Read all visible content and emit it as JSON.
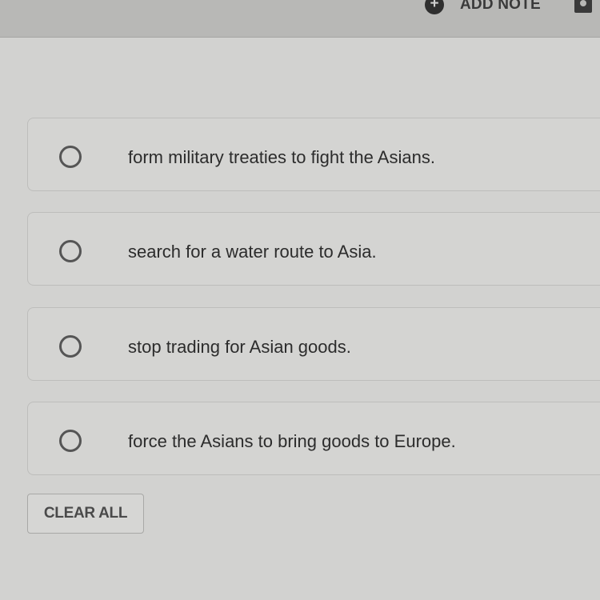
{
  "header": {
    "add_note_icon": "plus-circle-icon",
    "add_note_label": "ADD NOTE",
    "note_icon": "note-icon"
  },
  "choices": [
    {
      "label": "form military treaties to fight the Asians.",
      "selected": false
    },
    {
      "label": "search for a water route to Asia.",
      "selected": false
    },
    {
      "label": "stop trading for Asian goods.",
      "selected": false
    },
    {
      "label": "force the Asians to bring goods to Europe.",
      "selected": false
    }
  ],
  "clear_all_label": "CLEAR ALL",
  "colors": {
    "background": "#d2d2d0",
    "text": "#2c2c2c",
    "border": "#bdbdbb"
  }
}
